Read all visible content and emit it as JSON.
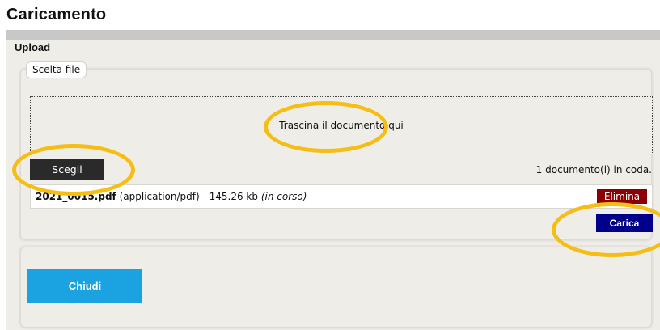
{
  "header": {
    "title": "Caricamento"
  },
  "section": {
    "label": "Upload"
  },
  "fieldset": {
    "legend": "Scelta file"
  },
  "dropzone": {
    "text": "Trascina il documento qui"
  },
  "actions": {
    "choose_label": "Scegli",
    "queue_text": "1 documento(i) in coda.",
    "upload_label": "Carica",
    "close_label": "Chiudi"
  },
  "file": {
    "name": "2021_0015.pdf",
    "type": "(application/pdf)",
    "size": "- 145.26 kb",
    "status": "(in corso)",
    "delete_label": "Elimina"
  },
  "colors": {
    "annotation": "#f6be14",
    "choose_button": "#2a2a2a",
    "delete_button": "#8b0000",
    "upload_button": "#00008b",
    "close_button": "#1aa3e0",
    "panel_bg": "#efede8"
  }
}
